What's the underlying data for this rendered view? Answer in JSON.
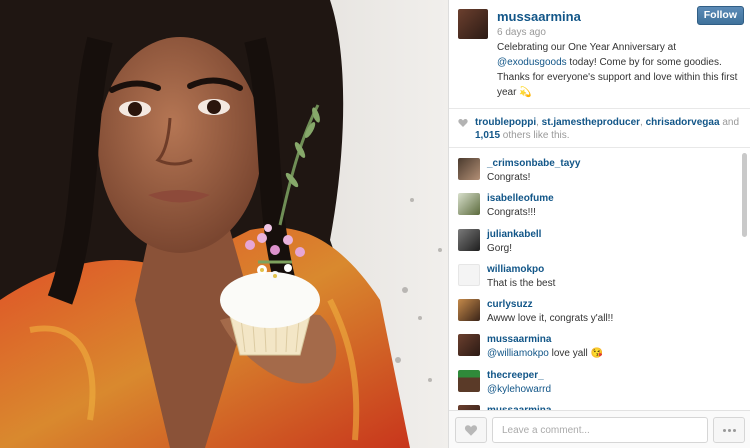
{
  "post": {
    "username": "mussaarmina",
    "follow_label": "Follow",
    "timestamp": "6 days ago",
    "caption_before": "Celebrating our One Year Anniversary at ",
    "caption_mention": "@exodusgoods",
    "caption_after": " today! Come by for some goodies. Thanks for everyone's support and love within this first year ",
    "caption_emoji": "💫"
  },
  "likes": {
    "users": [
      "troublepoppi",
      "st.jamestheproducer",
      "chrisadorvegaa"
    ],
    "and_text": " and",
    "others_count": "1,015",
    "others_text": " others like this."
  },
  "comments": [
    {
      "user": "_crimsonbabe_tayy",
      "text": "Congrats!"
    },
    {
      "user": "isabelleofume",
      "text": "Congrats!!!"
    },
    {
      "user": "juliankabell",
      "text": "Gorg!"
    },
    {
      "user": "williamokpo",
      "text": "That is the best"
    },
    {
      "user": "curlysuzz",
      "text": "Awww love it, congrats y'all!!"
    },
    {
      "user": "mussaarmina",
      "mention": "@williamokpo",
      "text": " love yall 😘"
    },
    {
      "user": "thecreeper_",
      "mention": "@kylehowarrd",
      "text": ""
    },
    {
      "user": "mussaarmina",
      "text": ""
    }
  ],
  "comment_bar": {
    "placeholder": "Leave a comment..."
  },
  "icons": {
    "like": "heart-icon",
    "more": "ellipsis-icon"
  },
  "colors": {
    "link": "#125688",
    "follow_button": "#3f729b"
  }
}
